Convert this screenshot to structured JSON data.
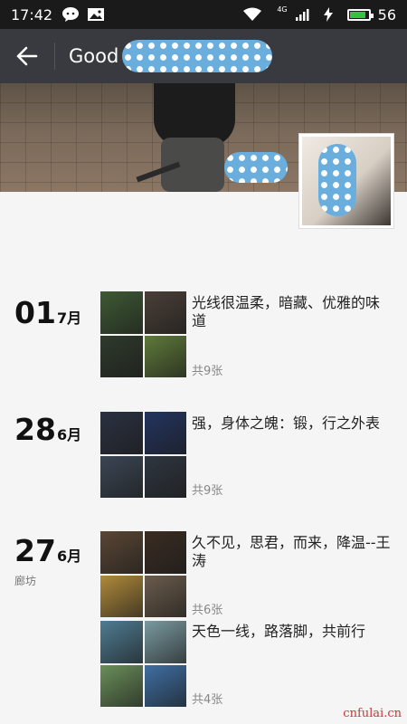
{
  "status_bar": {
    "time": "17:42",
    "network_label": "4G",
    "battery_percent": "56",
    "battery_level": 0.85,
    "icons": [
      "chat-icon",
      "image-icon",
      "wifi-icon",
      "signal-icon",
      "charging-icon",
      "battery-icon"
    ]
  },
  "header": {
    "title": "Good",
    "back_icon": "back-arrow-icon"
  },
  "timeline": [
    {
      "day": "01",
      "month": "7月",
      "location": "",
      "posts": [
        {
          "caption": "光线很温柔，暗藏、优雅的味道",
          "count": "共9张",
          "colors": [
            "#3e5a34",
            "#4a3f37",
            "#2f3a2c",
            "#5f7a3a"
          ]
        }
      ]
    },
    {
      "day": "28",
      "month": "6月",
      "location": "",
      "posts": [
        {
          "caption": "强，身体之魄：锻，行之外表",
          "count": "共9张",
          "colors": [
            "#2b3141",
            "#23345f",
            "#3b4654",
            "#2f3640"
          ]
        }
      ]
    },
    {
      "day": "27",
      "month": "6月",
      "location": "廊坊",
      "posts": [
        {
          "caption": "久不见，思君，而来，降温--王涛",
          "count": "共6张",
          "colors": [
            "#5a4634",
            "#3a2c22",
            "#b08a3a",
            "#6b5c4c"
          ]
        },
        {
          "caption": "天色一线，路落脚，共前行",
          "count": "共4张",
          "colors": [
            "#4f7c92",
            "#7a9aa0",
            "#6a8f5a",
            "#3f6fa3"
          ]
        }
      ]
    }
  ],
  "watermark": "cnfulai.cn"
}
